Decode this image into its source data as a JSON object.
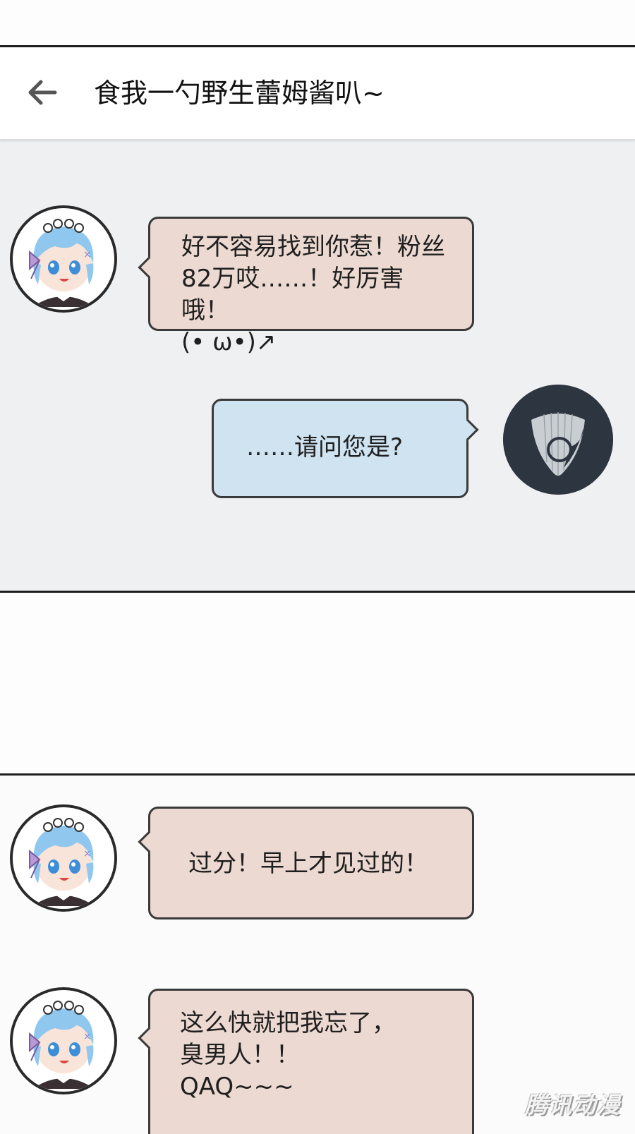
{
  "chat": {
    "title": "食我一勺野生蕾姆酱叭~"
  },
  "messages": [
    {
      "sender": "rem",
      "side": "left",
      "text": "好不容易找到你惹！粉丝\n82万哎……！好厉害哦！\n(• ω•)↗"
    },
    {
      "sender": "guitar-pick",
      "side": "right",
      "text": "……请问您是?"
    },
    {
      "sender": "rem",
      "side": "left",
      "text": "过分！早上才见过的！"
    },
    {
      "sender": "rem",
      "side": "left",
      "text": "这么快就把我忘了，\n臭男人！！\nQAQ~~~"
    }
  ],
  "icons": {
    "back": "arrow-left-icon",
    "avatar_rem": "rem-avatar",
    "avatar_self": "guitar-pick-avatar"
  },
  "colors": {
    "chat_background": "#eff0f2",
    "bubble_pink": "#ecd9d1",
    "bubble_blue": "#cfe3f1",
    "panel_border": "#1d1d1d",
    "self_avatar": "#2c3540"
  },
  "watermark": "腾讯动漫"
}
